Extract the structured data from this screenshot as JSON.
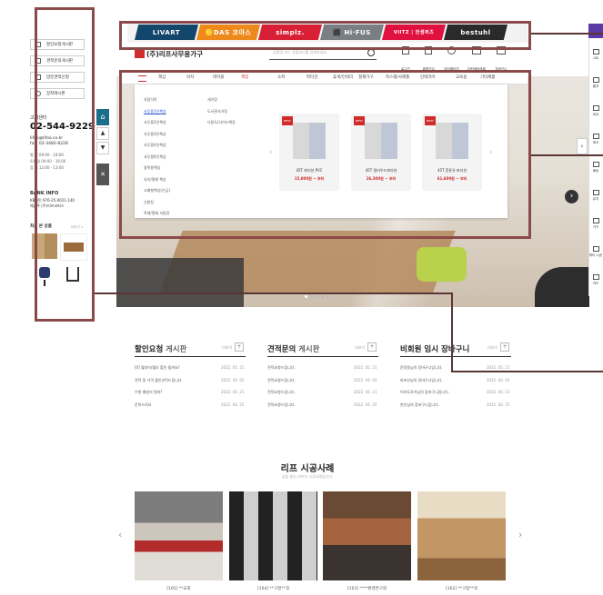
{
  "brands": [
    {
      "label": "LIVART",
      "color": "#12466b"
    },
    {
      "label": "🟡DAS 코아스",
      "color": "#ee8a1c"
    },
    {
      "label": "simplz.",
      "color": "#d81f35"
    },
    {
      "label": "⬛ Hi·FUS",
      "color": "#7a7f86"
    },
    {
      "label": "VIITZ | 한샘퍼즈",
      "color": "#e0113f"
    },
    {
      "label": "bestuhl",
      "color": "#2a2a2a"
    }
  ],
  "header": {
    "logo": "(주)리프사무용가구",
    "search_placeholder": "상품명 또는 상품코드를 검색하세요",
    "icons": [
      "로그인",
      "회원가입",
      "마이페이지",
      "주문/배송조회",
      "장바구니"
    ]
  },
  "left_panel": {
    "buttons": [
      "할인요청게시판",
      "견적문의게시판",
      "방문견적신청",
      "장착에시판"
    ],
    "center_title": "고객센터",
    "phone": "02-544-9229",
    "email": "lifoo@lifoo.co.kr",
    "fax": "fax. 02-3482-8228",
    "hours": [
      "평 일  09:00 - 18:00",
      "토요일  09:00 - 16:00",
      "점 심  12:00 - 13:00"
    ],
    "bank_title": "BANK INFO",
    "bank_line": "KB국민  976-25-0021-140",
    "holder": "예금주  (주)리프코퍼스",
    "recent_title": "최근 본 상품",
    "recent_more": "더보기 >"
  },
  "nav": {
    "categories": [
      "책상",
      "의자",
      "테이블",
      "책장",
      "소파",
      "파티션",
      "휴게/인테리",
      "철재가구",
      "피스텔/사례틀",
      "인테리어",
      "교육용",
      "기타제품"
    ]
  },
  "mega": {
    "sub1": [
      "유럽식탁",
      "사무용1인책상",
      "사무용2인책상",
      "사무용3인책상",
      "사무용4인책상",
      "사무용6인책상",
      "중역용책상",
      "유리/철재 책상",
      "고배형책상(은금)",
      "신발장",
      "목재/철재 서랍장"
    ],
    "sub2": [
      "세기장",
      "도서관서가장",
      "다용도/사이드책장"
    ],
    "products": [
      {
        "badge": "BEST",
        "name": "45T 파티션 PVC",
        "price": "15,800원 ~ 부터"
      },
      {
        "badge": "BEST",
        "name": "45T 컬러우드파티션",
        "price": "26,300원 ~ 부터"
      },
      {
        "badge": "BEST",
        "name": "45T 혼폰유 파티션",
        "price": "61,600원 ~ 부터"
      }
    ]
  },
  "boards": [
    {
      "title": "할인요청",
      "title2": " 게시판",
      "more": "더보기",
      "rows": [
        [
          "[0] 월부터/월부 할인 될까요?",
          "2022. 05. 21"
        ],
        [
          "견적 및 가격 할인부탁드립니다.",
          "2022. 04. 03"
        ],
        [
          "수원 배송비 얼마?",
          "2022. 04. 21"
        ],
        [
          "문의드려요",
          "2022. 04. 25"
        ]
      ]
    },
    {
      "title": "견적문의",
      "title2": " 게시판",
      "more": "더보기",
      "rows": [
        [
          "견적요청드립니다.",
          "2022. 05. 21"
        ],
        [
          "견적요청드립니다.",
          "2022. 04. 03"
        ],
        [
          "견적요청드립니다.",
          "2022. 04. 21"
        ],
        [
          "견적요청드립니다.",
          "2022. 04. 25"
        ]
      ]
    },
    {
      "title": "비회원 임시 장바구니",
      "title2": "",
      "more": "더보기",
      "rows": [
        [
          "문경동님의 장바구니입니다.",
          "2022. 05. 21"
        ],
        [
          "마포산님의 장바구니입니다.",
          "2022. 04. 03"
        ],
        [
          "이카도루키님의 장바구니입니다.",
          "2022. 04. 21"
        ],
        [
          "한유님의 장바구니입니다.",
          "2022. 04. 25"
        ]
      ]
    }
  ],
  "cases": {
    "title": "리프 시공사례",
    "subtitle": "공을 들인 리프의 시공사례입니다.",
    "items": [
      "[165] **교회",
      "[164] **구청**과",
      "[163] ****환경연구원",
      "[162] **구청**과"
    ]
  },
  "right_sidebar": [
    "시트",
    "즐겨",
    "비교",
    "재고",
    "배송",
    "유지",
    "가구",
    "파티 시공",
    "카드"
  ],
  "colors": {
    "highlight": "#8b4a4a",
    "accent_red": "#d12b2b"
  }
}
